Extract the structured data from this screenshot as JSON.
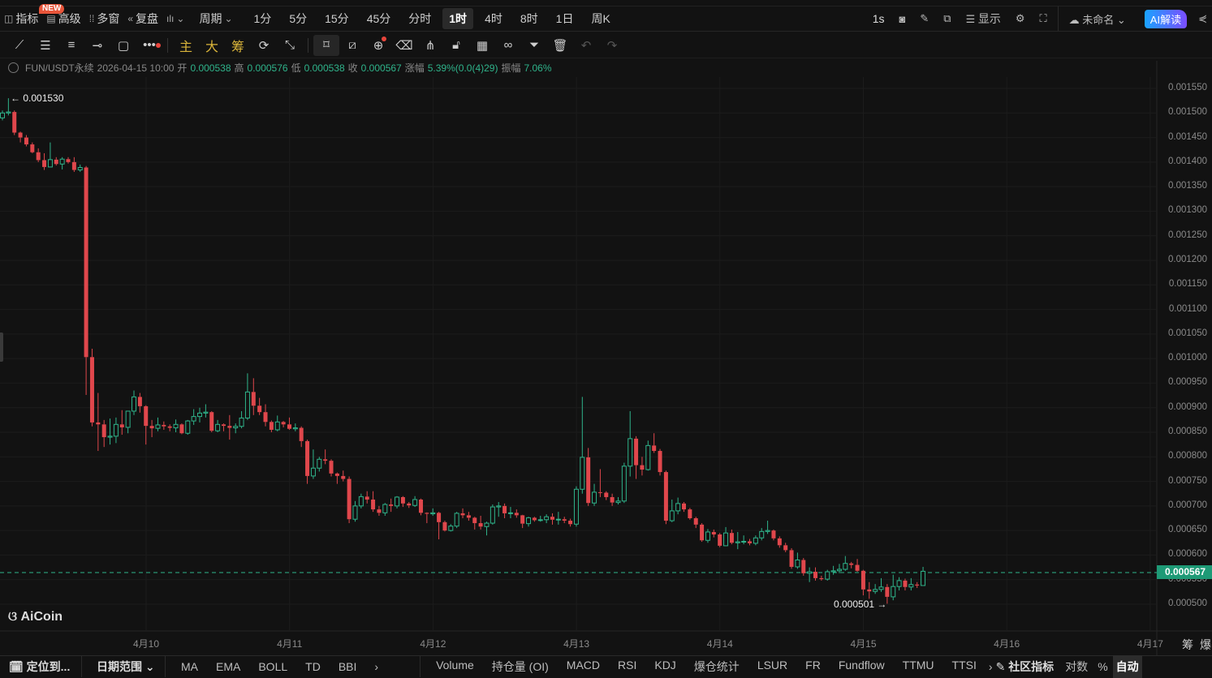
{
  "topbar": {
    "new_badge": "NEW",
    "indicators": "指标",
    "advanced": "高级",
    "multi_window": "多窗",
    "replay": "复盘",
    "period_label": "周期",
    "periods": [
      "1分",
      "5分",
      "15分",
      "45分",
      "分时",
      "1时",
      "4时",
      "8时",
      "1日",
      "周K"
    ],
    "active_period": "1时",
    "refresh": "1s",
    "display": "显示",
    "layout_name": "未命名",
    "ai_button": "AI解读"
  },
  "drawbar": {
    "main": "主",
    "big": "大",
    "chips": "筹"
  },
  "info": {
    "symbol": "FUN/USDT永续",
    "datetime": "2026-04-15 10:00",
    "open_label": "开",
    "open": "0.000538",
    "high_label": "高",
    "high": "0.000576",
    "low_label": "低",
    "low": "0.000538",
    "close_label": "收",
    "close": "0.000567",
    "change_label": "涨幅",
    "change": "5.39%(0.0(4)29)",
    "amplitude_label": "振幅",
    "amplitude": "7.06%"
  },
  "labels": {
    "max_marker": "← 0.001530",
    "min_marker": "0.000501 →",
    "current_price": "0.000567",
    "logo": "AiCoin",
    "chips_corner": "筹",
    "liq_corner": "爆"
  },
  "colors": {
    "up": "#2fb48b",
    "down": "#e0474c",
    "current": "#1e9a76"
  },
  "chart_data": {
    "type": "candlestick",
    "interval": "1h",
    "yaxis_ticks": [
      "0.001550",
      "0.001500",
      "0.001450",
      "0.001400",
      "0.001350",
      "0.001300",
      "0.001250",
      "0.001200",
      "0.001150",
      "0.001100",
      "0.001050",
      "0.001000",
      "0.000950",
      "0.000900",
      "0.000850",
      "0.000800",
      "0.000750",
      "0.000700",
      "0.000650",
      "0.000600",
      "0.000550",
      "0.000500"
    ],
    "ylim": [
      0.0005,
      0.00155
    ],
    "xaxis_ticks": [
      "4月10",
      "4月11",
      "4月12",
      "4月13",
      "4月14",
      "4月15",
      "4月16",
      "4月17"
    ],
    "current_price": 0.000567,
    "candles_ohlc": [
      [
        0.00149,
        0.001505,
        0.001485,
        0.0015
      ],
      [
        0.0015,
        0.00153,
        0.001495,
        0.001502
      ],
      [
        0.001502,
        0.001505,
        0.001455,
        0.00146
      ],
      [
        0.00146,
        0.001462,
        0.00144,
        0.00145
      ],
      [
        0.00145,
        0.001455,
        0.001432,
        0.001436
      ],
      [
        0.001436,
        0.00144,
        0.001418,
        0.00142
      ],
      [
        0.00142,
        0.001428,
        0.0014,
        0.001404
      ],
      [
        0.001404,
        0.001418,
        0.001384,
        0.00139
      ],
      [
        0.00139,
        0.00144,
        0.00139,
        0.001405
      ],
      [
        0.001405,
        0.00141,
        0.001393,
        0.001396
      ],
      [
        0.001396,
        0.00141,
        0.001385,
        0.001406
      ],
      [
        0.001406,
        0.00141,
        0.001397,
        0.0014
      ],
      [
        0.0014,
        0.00141,
        0.00138,
        0.001384
      ],
      [
        0.001384,
        0.001395,
        0.00138,
        0.001389
      ],
      [
        0.001389,
        0.001392,
        0.000926,
        0.001003
      ],
      [
        0.001003,
        0.00102,
        0.000862,
        0.00087
      ],
      [
        0.00087,
        0.00093,
        0.000812,
        0.000866
      ],
      [
        0.000866,
        0.000875,
        0.00082,
        0.00084
      ],
      [
        0.00084,
        0.000878,
        0.000825,
        0.000842
      ],
      [
        0.000842,
        0.00088,
        0.000828,
        0.000866
      ],
      [
        0.000866,
        0.000895,
        0.000845,
        0.00086
      ],
      [
        0.00086,
        0.000893,
        0.000848,
        0.000893
      ],
      [
        0.000893,
        0.000935,
        0.000885,
        0.000922
      ],
      [
        0.000922,
        0.00093,
        0.00089,
        0.000903
      ],
      [
        0.000903,
        0.000905,
        0.000825,
        0.000863
      ],
      [
        0.000863,
        0.000875,
        0.00084,
        0.000858
      ],
      [
        0.000858,
        0.00088,
        0.000852,
        0.000865
      ],
      [
        0.000865,
        0.000872,
        0.000855,
        0.000862
      ],
      [
        0.000862,
        0.000866,
        0.000852,
        0.000859
      ],
      [
        0.000859,
        0.000876,
        0.00085,
        0.000866
      ],
      [
        0.000866,
        0.000868,
        0.000846,
        0.000848
      ],
      [
        0.000848,
        0.000875,
        0.000845,
        0.000873
      ],
      [
        0.000873,
        0.000897,
        0.000865,
        0.000882
      ],
      [
        0.000882,
        0.0009,
        0.00087,
        0.000889
      ],
      [
        0.000889,
        0.000907,
        0.00088,
        0.000891
      ],
      [
        0.000891,
        0.000893,
        0.00085,
        0.000853
      ],
      [
        0.000853,
        0.000875,
        0.00085,
        0.000866
      ],
      [
        0.000866,
        0.000868,
        0.000852,
        0.000863
      ],
      [
        0.000863,
        0.000885,
        0.000835,
        0.000859
      ],
      [
        0.000859,
        0.000868,
        0.000848,
        0.000862
      ],
      [
        0.000862,
        0.000893,
        0.000858,
        0.000879
      ],
      [
        0.000879,
        0.00097,
        0.000875,
        0.000932
      ],
      [
        0.000932,
        0.00096,
        0.000885,
        0.000904
      ],
      [
        0.000904,
        0.00092,
        0.000885,
        0.000891
      ],
      [
        0.000891,
        0.000907,
        0.000862,
        0.000871
      ],
      [
        0.000871,
        0.000874,
        0.00085,
        0.000855
      ],
      [
        0.000855,
        0.000884,
        0.000852,
        0.000871
      ],
      [
        0.000871,
        0.000873,
        0.00086,
        0.000866
      ],
      [
        0.000866,
        0.00088,
        0.000855,
        0.000857
      ],
      [
        0.000857,
        0.000868,
        0.000852,
        0.000859
      ],
      [
        0.000859,
        0.000862,
        0.00082,
        0.000832
      ],
      [
        0.000832,
        0.000835,
        0.000745,
        0.000761
      ],
      [
        0.000761,
        0.000815,
        0.000755,
        0.000777
      ],
      [
        0.000777,
        0.0008,
        0.00077,
        0.000795
      ],
      [
        0.000795,
        0.000815,
        0.000785,
        0.000792
      ],
      [
        0.000792,
        0.000795,
        0.00076,
        0.000766
      ],
      [
        0.000766,
        0.000768,
        0.000745,
        0.000761
      ],
      [
        0.000761,
        0.000772,
        0.00075,
        0.000755
      ],
      [
        0.000755,
        0.00076,
        0.000665,
        0.000673
      ],
      [
        0.000673,
        0.00071,
        0.000668,
        0.0007
      ],
      [
        0.0007,
        0.000725,
        0.000695,
        0.000719
      ],
      [
        0.000719,
        0.00073,
        0.000705,
        0.000713
      ],
      [
        0.000713,
        0.00073,
        0.000688,
        0.000693
      ],
      [
        0.000693,
        0.0007,
        0.00068,
        0.000686
      ],
      [
        0.000686,
        0.000706,
        0.00068,
        0.000703
      ],
      [
        0.000703,
        0.000715,
        0.000688,
        0.0007
      ],
      [
        0.0007,
        0.00072,
        0.000695,
        0.000718
      ],
      [
        0.000718,
        0.00072,
        0.000698,
        0.000705
      ],
      [
        0.000705,
        0.000708,
        0.000696,
        0.000701
      ],
      [
        0.000701,
        0.00072,
        0.000698,
        0.000713
      ],
      [
        0.000713,
        0.000715,
        0.000681,
        0.000686
      ],
      [
        0.000686,
        0.000687,
        0.000665,
        0.000684
      ],
      [
        0.000684,
        0.000695,
        0.00068,
        0.000686
      ],
      [
        0.000686,
        0.000688,
        0.000632,
        0.000667
      ],
      [
        0.000667,
        0.00067,
        0.000648,
        0.00065
      ],
      [
        0.00065,
        0.000663,
        0.000648,
        0.000659
      ],
      [
        0.000659,
        0.000688,
        0.000655,
        0.000685
      ],
      [
        0.000685,
        0.000695,
        0.000675,
        0.000681
      ],
      [
        0.000681,
        0.000688,
        0.00067,
        0.000676
      ],
      [
        0.000676,
        0.000678,
        0.000652,
        0.000665
      ],
      [
        0.000665,
        0.00068,
        0.000652,
        0.000658
      ],
      [
        0.000658,
        0.000668,
        0.00064,
        0.000665
      ],
      [
        0.000665,
        0.000703,
        0.000662,
        0.000698
      ],
      [
        0.000698,
        0.000708,
        0.000678,
        0.0007
      ],
      [
        0.0007,
        0.000705,
        0.000675,
        0.000685
      ],
      [
        0.000685,
        0.000698,
        0.000675,
        0.000686
      ],
      [
        0.000686,
        0.000693,
        0.000676,
        0.000681
      ],
      [
        0.000681,
        0.000682,
        0.000655,
        0.000664
      ],
      [
        0.000664,
        0.000678,
        0.000658,
        0.000676
      ],
      [
        0.000676,
        0.000678,
        0.000668,
        0.000671
      ],
      [
        0.000671,
        0.00068,
        0.000668,
        0.000672
      ],
      [
        0.000672,
        0.000683,
        0.000665,
        0.000678
      ],
      [
        0.000678,
        0.000685,
        0.000662,
        0.000672
      ],
      [
        0.000672,
        0.000688,
        0.000662,
        0.000673
      ],
      [
        0.000673,
        0.000678,
        0.000665,
        0.00067
      ],
      [
        0.00067,
        0.000674,
        0.000658,
        0.000663
      ],
      [
        0.000663,
        0.00074,
        0.000658,
        0.000734
      ],
      [
        0.000734,
        0.000922,
        0.000725,
        0.000799
      ],
      [
        0.000799,
        0.000818,
        0.0007,
        0.000706
      ],
      [
        0.000706,
        0.000745,
        0.0007,
        0.000728
      ],
      [
        0.000728,
        0.000775,
        0.000718,
        0.000727
      ],
      [
        0.000727,
        0.00073,
        0.000712,
        0.000718
      ],
      [
        0.000718,
        0.000725,
        0.0007,
        0.000707
      ],
      [
        0.000707,
        0.000718,
        0.000703,
        0.00071
      ],
      [
        0.00071,
        0.000788,
        0.000706,
        0.000781
      ],
      [
        0.000781,
        0.000893,
        0.00076,
        0.000837
      ],
      [
        0.000837,
        0.000842,
        0.000755,
        0.000783
      ],
      [
        0.000783,
        0.0008,
        0.000762,
        0.000774
      ],
      [
        0.000774,
        0.000833,
        0.000772,
        0.000823
      ],
      [
        0.000823,
        0.000848,
        0.000808,
        0.000812
      ],
      [
        0.000812,
        0.000816,
        0.000762,
        0.000769
      ],
      [
        0.000769,
        0.000772,
        0.000663,
        0.00067
      ],
      [
        0.00067,
        0.000713,
        0.000667,
        0.00069
      ],
      [
        0.00069,
        0.000717,
        0.000683,
        0.000705
      ],
      [
        0.000705,
        0.000708,
        0.000688,
        0.000693
      ],
      [
        0.000693,
        0.000696,
        0.000672,
        0.000675
      ],
      [
        0.000675,
        0.000678,
        0.000655,
        0.000662
      ],
      [
        0.000662,
        0.000665,
        0.000627,
        0.00063
      ],
      [
        0.00063,
        0.000653,
        0.000625,
        0.000647
      ],
      [
        0.000647,
        0.000652,
        0.000636,
        0.000642
      ],
      [
        0.000642,
        0.000645,
        0.000616,
        0.000619
      ],
      [
        0.000619,
        0.000657,
        0.000618,
        0.000645
      ],
      [
        0.000645,
        0.000652,
        0.000622,
        0.000625
      ],
      [
        0.000625,
        0.000647,
        0.000612,
        0.000627
      ],
      [
        0.000627,
        0.00064,
        0.000622,
        0.000628
      ],
      [
        0.000628,
        0.000633,
        0.00062,
        0.000624
      ],
      [
        0.000624,
        0.00064,
        0.00062,
        0.000635
      ],
      [
        0.000635,
        0.000655,
        0.00063,
        0.000648
      ],
      [
        0.000648,
        0.00067,
        0.000643,
        0.00065
      ],
      [
        0.00065,
        0.000652,
        0.00063,
        0.000634
      ],
      [
        0.000634,
        0.000638,
        0.000615,
        0.00062
      ],
      [
        0.00062,
        0.000625,
        0.000606,
        0.00061
      ],
      [
        0.00061,
        0.000614,
        0.000572,
        0.000576
      ],
      [
        0.000576,
        0.000605,
        0.000572,
        0.00059
      ],
      [
        0.00059,
        0.000594,
        0.000558,
        0.000563
      ],
      [
        0.000563,
        0.000575,
        0.000545,
        0.000566
      ],
      [
        0.000566,
        0.000575,
        0.000548,
        0.000553
      ],
      [
        0.000553,
        0.000558,
        0.000548,
        0.000551
      ],
      [
        0.000551,
        0.00057,
        0.000548,
        0.000566
      ],
      [
        0.000566,
        0.000578,
        0.00056,
        0.000568
      ],
      [
        0.000568,
        0.000582,
        0.000563,
        0.000571
      ],
      [
        0.000571,
        0.000598,
        0.000568,
        0.000583
      ],
      [
        0.000583,
        0.000586,
        0.000573,
        0.00058
      ],
      [
        0.00058,
        0.000592,
        0.000566,
        0.000568
      ],
      [
        0.000568,
        0.00057,
        0.000518,
        0.00053
      ],
      [
        0.00053,
        0.000545,
        0.000511,
        0.000526
      ],
      [
        0.000526,
        0.000541,
        0.000521,
        0.00053
      ],
      [
        0.00053,
        0.000553,
        0.000525,
        0.000535
      ],
      [
        0.000535,
        0.000541,
        0.000501,
        0.000515
      ],
      [
        0.000515,
        0.00056,
        0.000508,
        0.000536
      ],
      [
        0.000536,
        0.000555,
        0.000528,
        0.000548
      ],
      [
        0.000548,
        0.000552,
        0.000528,
        0.000535
      ],
      [
        0.000535,
        0.000553,
        0.000528,
        0.00054
      ],
      [
        0.00054,
        0.000545,
        0.000533,
        0.000538
      ],
      [
        0.000538,
        0.000576,
        0.000538,
        0.000567
      ]
    ]
  },
  "bottombar": {
    "locate": "定位到...",
    "date_range": "日期范围",
    "main_indicators": [
      "MA",
      "EMA",
      "BOLL",
      "TD",
      "BBI"
    ],
    "sub_indicators": [
      "Volume",
      "持仓量 (OI)",
      "MACD",
      "RSI",
      "KDJ",
      "爆仓统计",
      "LSUR",
      "FR",
      "Fundflow",
      "TTMU",
      "TTSI"
    ],
    "community": "社区指标",
    "log": "对数",
    "percent": "%",
    "auto": "自动"
  }
}
